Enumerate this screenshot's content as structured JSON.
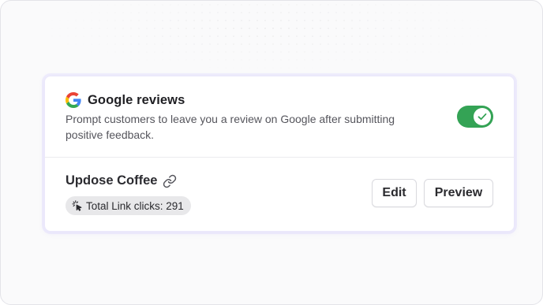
{
  "integration": {
    "title": "Google reviews",
    "description": "Prompt customers to leave you a review on Google after submitting positive feedback.",
    "icon": "google-logo-icon",
    "enabled": true,
    "toggle_color": "#34a355"
  },
  "link": {
    "name": "Updose Coffee",
    "icon": "link-icon",
    "clicks_label": "Total Link clicks: 291",
    "clicks_icon": "cursor-click-icon"
  },
  "actions": {
    "edit_label": "Edit",
    "preview_label": "Preview"
  }
}
